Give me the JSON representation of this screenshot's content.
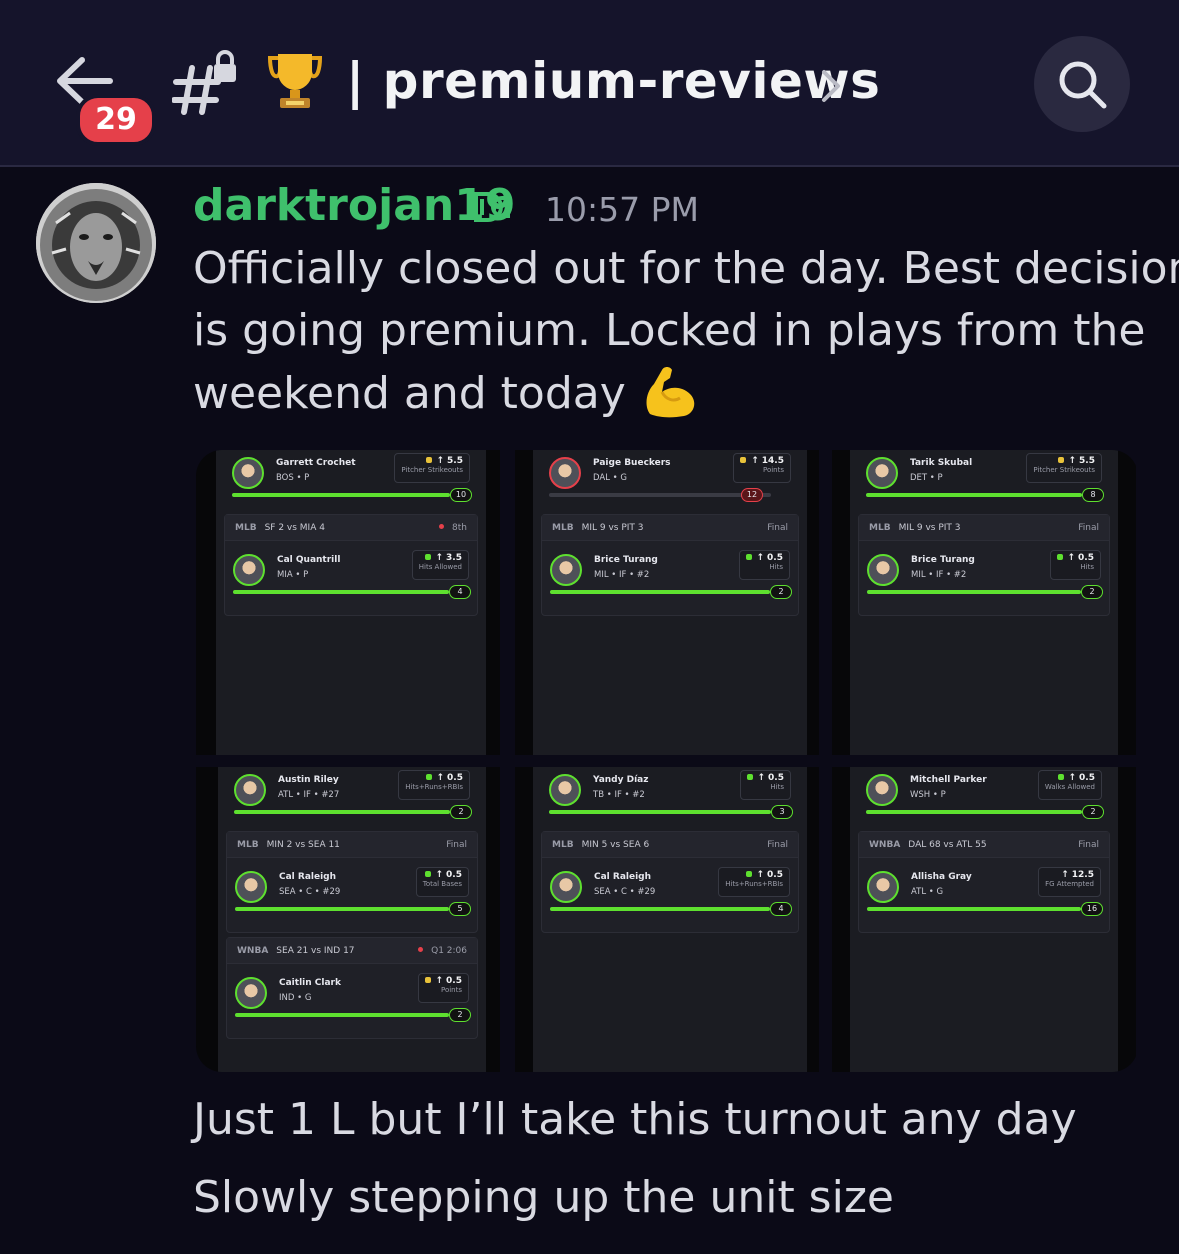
{
  "header": {
    "unread_count": "29",
    "channel_title": "| premium-reviews"
  },
  "message": {
    "author": "darktrojan19",
    "timestamp": "10:57 PM",
    "text_lines": [
      "Officially closed out for the day. Best decision",
      "is going premium. Locked in plays from the",
      "weekend and today"
    ],
    "followups": [
      "Just 1 L but I’ll take this turnout any day",
      "Slowly stepping up the unit size"
    ]
  },
  "screenshots": [
    {
      "top_player": {
        "name": "Garrett Crochet",
        "pos": "BOS • P",
        "line": "5.5",
        "market": "Pitcher Strikeouts",
        "result": "10",
        "status": "win",
        "icon": "gold"
      },
      "game": {
        "league": "MLB",
        "matchup": "SF 2 vs MIA 4",
        "status": "8th",
        "live": true,
        "player": {
          "name": "Cal Quantrill",
          "pos": "MIA • P",
          "line": "3.5",
          "market": "Hits Allowed",
          "result": "4",
          "status": "win",
          "icon": "green"
        }
      }
    },
    {
      "top_player": {
        "name": "Paige Bueckers",
        "pos": "DAL • G",
        "line": "14.5",
        "market": "Points",
        "result": "12",
        "status": "loss",
        "icon": "gold"
      },
      "game": {
        "league": "MLB",
        "matchup": "MIL 9 vs PIT 3",
        "status": "Final",
        "live": false,
        "player": {
          "name": "Brice Turang",
          "pos": "MIL • IF • #2",
          "line": "0.5",
          "market": "Hits",
          "result": "2",
          "status": "win",
          "icon": "green"
        }
      }
    },
    {
      "top_player": {
        "name": "Tarik Skubal",
        "pos": "DET • P",
        "line": "5.5",
        "market": "Pitcher Strikeouts",
        "result": "8",
        "status": "win",
        "icon": "gold"
      },
      "game": {
        "league": "MLB",
        "matchup": "MIL 9 vs PIT 3",
        "status": "Final",
        "live": false,
        "player": {
          "name": "Brice Turang",
          "pos": "MIL • IF • #2",
          "line": "0.5",
          "market": "Hits",
          "result": "2",
          "status": "win",
          "icon": "green"
        }
      }
    },
    {
      "top_player": {
        "name": "Austin Riley",
        "pos": "ATL • IF • #27",
        "line": "0.5",
        "market": "Hits+Runs+RBIs",
        "result": "2",
        "status": "win",
        "icon": "green"
      },
      "games": [
        {
          "league": "MLB",
          "matchup": "MIN 2 vs SEA 11",
          "status": "Final",
          "live": false,
          "player": {
            "name": "Cal Raleigh",
            "pos": "SEA • C • #29",
            "line": "0.5",
            "market": "Total Bases",
            "result": "5",
            "status": "win",
            "icon": "green"
          }
        },
        {
          "league": "WNBA",
          "matchup": "SEA 21 vs IND 17",
          "status": "Q1 2:06",
          "live": true,
          "player": {
            "name": "Caitlin Clark",
            "pos": "IND • G",
            "line": "0.5",
            "market": "Points",
            "result": "2",
            "status": "win",
            "icon": "gold"
          }
        }
      ]
    },
    {
      "top_player": {
        "name": "Yandy Díaz",
        "pos": "TB • IF • #2",
        "line": "0.5",
        "market": "Hits",
        "result": "3",
        "status": "win",
        "icon": "green"
      },
      "games": [
        {
          "league": "MLB",
          "matchup": "MIN 5 vs SEA 6",
          "status": "Final",
          "live": false,
          "player": {
            "name": "Cal Raleigh",
            "pos": "SEA • C • #29",
            "line": "0.5",
            "market": "Hits+Runs+RBIs",
            "result": "4",
            "status": "win",
            "icon": "green"
          }
        }
      ]
    },
    {
      "top_player": {
        "name": "Mitchell Parker",
        "pos": "WSH • P",
        "line": "0.5",
        "market": "Walks Allowed",
        "result": "2",
        "status": "win",
        "icon": "green"
      },
      "games": [
        {
          "league": "WNBA",
          "matchup": "DAL 68 vs ATL 55",
          "status": "Final",
          "live": false,
          "player": {
            "name": "Allisha Gray",
            "pos": "ATL • G",
            "line": "12.5",
            "market": "FG Attempted",
            "result": "16",
            "status": "win",
            "icon": "none"
          }
        }
      ]
    }
  ],
  "colors": {
    "header_bg": "#15142b",
    "body_bg": "#0b0a17",
    "username": "#3fc06c",
    "badge": "#e5404a",
    "win": "#5ee02f",
    "loss": "#e5404a"
  },
  "icons": [
    "back-arrow-icon",
    "locked-hash-icon",
    "trophy-icon",
    "chevron-right-icon",
    "search-icon",
    "flexed-biceps-emoji",
    "verified-tag-icon"
  ]
}
